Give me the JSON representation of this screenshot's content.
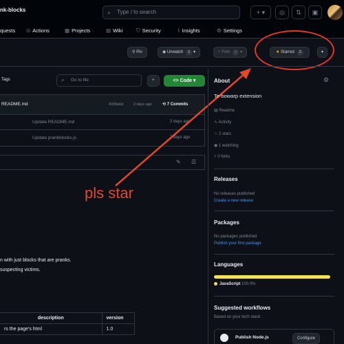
{
  "header": {
    "repo_name": "nk-blocks",
    "search_placeholder": "Type / to search",
    "search_slash": "/",
    "plus_label": "+ ▾"
  },
  "tabs": [
    {
      "label": "quests",
      "icon": ""
    },
    {
      "label": "Actions",
      "icon": "play-circle-icon"
    },
    {
      "label": "Projects",
      "icon": "table-icon"
    },
    {
      "label": "Wiki",
      "icon": "book-icon"
    },
    {
      "label": "Security",
      "icon": "shield-icon"
    },
    {
      "label": "Insights",
      "icon": "graph-icon"
    },
    {
      "label": "Settings",
      "icon": "gear-icon"
    }
  ],
  "actions": {
    "pin": "Pin",
    "unwatch": "Unwatch",
    "unwatch_count": "1",
    "fork": "Fork",
    "fork_count": "0",
    "starred": "Starred",
    "starred_count": "2"
  },
  "files": {
    "tags_label": "Tags",
    "go_to_file": "Go to file",
    "add_label": "+",
    "code_label": "Code",
    "commit_file": "README.md",
    "commit_hash": "4339a6d",
    "commit_time": "2 days ago",
    "commits": "7 Commits",
    "rows": [
      {
        "message": "Update README.md",
        "time": "2 days ago"
      },
      {
        "message": "Update prankblocks.js",
        "time": "2 days ago"
      }
    ]
  },
  "readme": {
    "line1": "n with just blocks that are pranks.",
    "line2": "suspecting victims.",
    "table_headers": [
      "description",
      "version"
    ],
    "table_row": [
      "rs the page's html",
      "1.0"
    ]
  },
  "about": {
    "title": "About",
    "description": "Te-bowarp extension",
    "items": [
      {
        "label": "Readme",
        "icon": "book-icon"
      },
      {
        "label": "Activity",
        "icon": "pulse-icon"
      },
      {
        "label": "2 stars",
        "icon": "star-icon"
      },
      {
        "label": "1 watching",
        "icon": "eye-icon"
      },
      {
        "label": "0 forks",
        "icon": "fork-icon"
      }
    ]
  },
  "releases": {
    "title": "Releases",
    "none": "No releases published",
    "create": "Create a new release"
  },
  "packages": {
    "title": "Packages",
    "none": "No packages published",
    "publish": "Publish your first package"
  },
  "languages": {
    "title": "Languages",
    "language": "JavaScript",
    "percent": "100.0%",
    "color": "#f1e05a"
  },
  "workflows": {
    "title": "Suggested workflows",
    "subtitle": "Based on your tech stack",
    "item": "Publish Node.js",
    "configure": "Configure"
  },
  "annotation": {
    "text": "pls star",
    "color": "#e5472b"
  }
}
